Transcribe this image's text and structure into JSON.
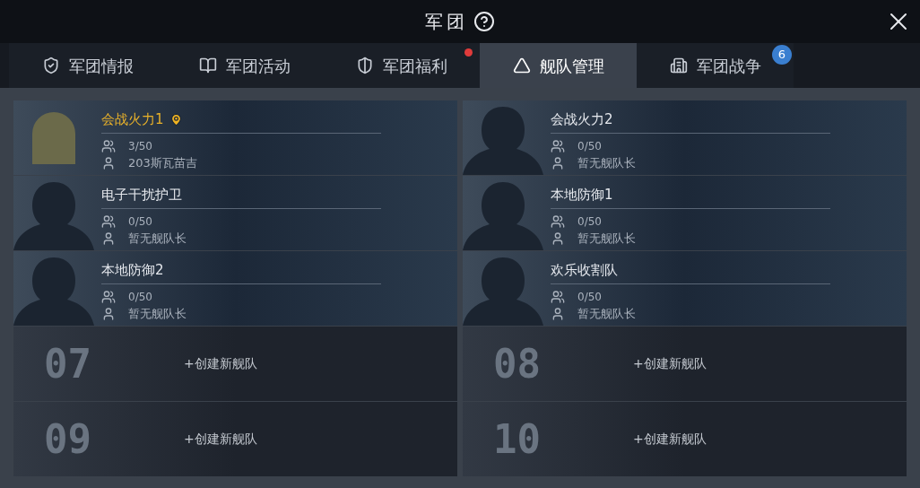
{
  "window": {
    "title": "军团"
  },
  "tabs": [
    {
      "label": "军团情报",
      "selected": false,
      "alert": false
    },
    {
      "label": "军团活动",
      "selected": false,
      "alert": false
    },
    {
      "label": "军团福利",
      "selected": false,
      "alert": true
    },
    {
      "label": "舰队管理",
      "selected": true,
      "alert": false
    },
    {
      "label": "军团战争",
      "selected": false,
      "alert": false,
      "badge": "6"
    }
  ],
  "fleets": [
    {
      "kind": "fleet",
      "name": "会战火力1",
      "mine": true,
      "has_portrait": true,
      "members": "3/50",
      "leader": "203斯瓦苗吉"
    },
    {
      "kind": "fleet",
      "name": "会战火力2",
      "mine": false,
      "has_portrait": false,
      "members": "0/50",
      "leader": "暂无舰队长"
    },
    {
      "kind": "fleet",
      "name": "电子干扰护卫",
      "mine": false,
      "has_portrait": false,
      "members": "0/50",
      "leader": "暂无舰队长"
    },
    {
      "kind": "fleet",
      "name": "本地防御1",
      "mine": false,
      "has_portrait": false,
      "members": "0/50",
      "leader": "暂无舰队长"
    },
    {
      "kind": "fleet",
      "name": "本地防御2",
      "mine": false,
      "has_portrait": false,
      "members": "0/50",
      "leader": "暂无舰队长"
    },
    {
      "kind": "fleet",
      "name": "欢乐收割队",
      "mine": false,
      "has_portrait": false,
      "members": "0/50",
      "leader": "暂无舰队长"
    },
    {
      "kind": "empty",
      "number": "07",
      "action": "+创建新舰队"
    },
    {
      "kind": "empty",
      "number": "08",
      "action": "+创建新舰队"
    },
    {
      "kind": "empty",
      "number": "09",
      "action": "+创建新舰队"
    },
    {
      "kind": "empty",
      "number": "10",
      "action": "+创建新舰队"
    }
  ]
}
